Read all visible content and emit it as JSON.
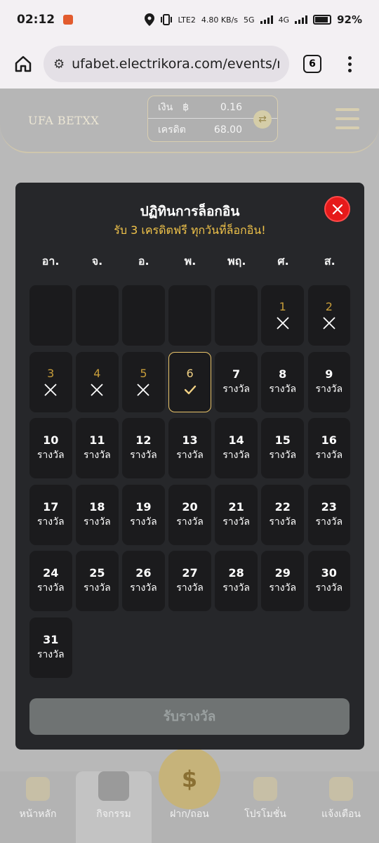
{
  "status_bar": {
    "time": "02:12",
    "net_info": "4.80 KB/s",
    "lte": "LTE2",
    "five_g": "5G",
    "four_g": "4G",
    "battery": "92%"
  },
  "browser": {
    "url": "ufabet.electrikora.com/events/r",
    "tab_count": "6"
  },
  "site_header": {
    "logo_text": "UFA BETXX",
    "wallet": {
      "cash_label": "เงิน",
      "currency_symbol": "฿",
      "cash_value": "0.16",
      "credit_label": "เครดิต",
      "credit_value": "68.00"
    }
  },
  "modal": {
    "title": "ปฏิทินการล็อกอิน",
    "subtitle": "รับ 3 เครดิตฟรี ทุกวันที่ล็อกอิน!",
    "weekdays": [
      "อา.",
      "จ.",
      "อ.",
      "พ.",
      "พฤ.",
      "ศ.",
      "ส."
    ],
    "reward_label": "รางวัล",
    "claim_button": "รับรางวัล",
    "leading_empty_days": 5,
    "days": [
      {
        "day": "1",
        "status": "missed"
      },
      {
        "day": "2",
        "status": "missed"
      },
      {
        "day": "3",
        "status": "missed"
      },
      {
        "day": "4",
        "status": "missed"
      },
      {
        "day": "5",
        "status": "missed"
      },
      {
        "day": "6",
        "status": "checked"
      },
      {
        "day": "7",
        "status": "upcoming"
      },
      {
        "day": "8",
        "status": "upcoming"
      },
      {
        "day": "9",
        "status": "upcoming"
      },
      {
        "day": "10",
        "status": "upcoming"
      },
      {
        "day": "11",
        "status": "upcoming"
      },
      {
        "day": "12",
        "status": "upcoming"
      },
      {
        "day": "13",
        "status": "upcoming"
      },
      {
        "day": "14",
        "status": "upcoming"
      },
      {
        "day": "15",
        "status": "upcoming"
      },
      {
        "day": "16",
        "status": "upcoming"
      },
      {
        "day": "17",
        "status": "upcoming"
      },
      {
        "day": "18",
        "status": "upcoming"
      },
      {
        "day": "19",
        "status": "upcoming"
      },
      {
        "day": "20",
        "status": "upcoming"
      },
      {
        "day": "21",
        "status": "upcoming"
      },
      {
        "day": "22",
        "status": "upcoming"
      },
      {
        "day": "23",
        "status": "upcoming"
      },
      {
        "day": "24",
        "status": "upcoming"
      },
      {
        "day": "25",
        "status": "upcoming"
      },
      {
        "day": "26",
        "status": "upcoming"
      },
      {
        "day": "27",
        "status": "upcoming"
      },
      {
        "day": "28",
        "status": "upcoming"
      },
      {
        "day": "29",
        "status": "upcoming"
      },
      {
        "day": "30",
        "status": "upcoming"
      },
      {
        "day": "31",
        "status": "upcoming"
      }
    ]
  },
  "bottom_nav": [
    {
      "label": "หน้าหลัก",
      "icon": "dice-icon"
    },
    {
      "label": "กิจกรรม",
      "icon": "gift-box-icon"
    },
    {
      "label": "ฝาก/ถอน",
      "icon": "coin-icon"
    },
    {
      "label": "โปรโมชั่น",
      "icon": "megaphone-icon"
    },
    {
      "label": "แจ้งเตือน",
      "icon": "bell-icon"
    }
  ],
  "colors": {
    "accent_gold": "#c79d3a",
    "today_border": "#e9c46a",
    "close_red": "#e61a1a",
    "modal_bg": "#26272a"
  }
}
